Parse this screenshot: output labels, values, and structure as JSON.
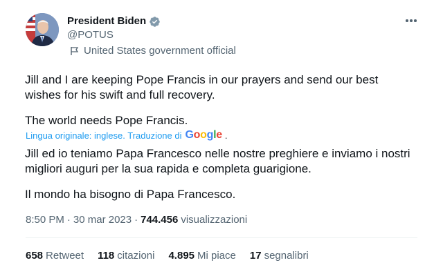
{
  "author": {
    "display_name": "President Biden",
    "handle": "@POTUS",
    "label": "United States government official"
  },
  "tweet": {
    "original": [
      "Jill and I are keeping Pope Francis in our prayers and send our best\nwishes for his swift and full recovery.",
      "The world needs Pope Francis."
    ],
    "translation_notice": "Lingua originale: inglese. Traduzione di",
    "translation_provider": "Google",
    "translated": [
      "Jill ed io teniamo Papa Francesco nelle nostre preghiere e inviamo i nostri\nmigliori auguri per la sua rapida e completa guarigione.",
      "Il mondo ha bisogno di Papa Francesco."
    ]
  },
  "meta": {
    "time": "8:50 PM",
    "date": "30 mar 2023",
    "views_count": "744.456",
    "views_label": "visualizzazioni"
  },
  "stats": {
    "retweets": {
      "count": "658",
      "label": "Retweet"
    },
    "quotes": {
      "count": "118",
      "label": "citazioni"
    },
    "likes": {
      "count": "4.895",
      "label": "Mi piace"
    },
    "bookmarks": {
      "count": "17",
      "label": "segnalibri"
    }
  },
  "colors": {
    "accent": "#1d9bf0",
    "text": "#0f1419",
    "secondary": "#536471"
  }
}
